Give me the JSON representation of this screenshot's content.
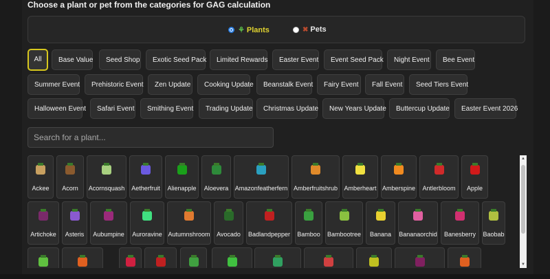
{
  "heading": "Choose a plant or pet from the categories for GAG calculation",
  "type_selector": {
    "plants_label": "Plants",
    "pets_label": "Pets",
    "selected": "Plants"
  },
  "categories": [
    "All",
    "Base Value",
    "Seed Shop",
    "Exotic Seed Pack",
    "Limited Rewards",
    "Easter Event",
    "Event Seed Pack",
    "Night Event",
    "Bee Event",
    "Summer Event",
    "Prehistoric Event",
    "Zen Update",
    "Cooking Update",
    "Beanstalk Event",
    "Fairy Event",
    "Fall Event",
    "Seed Tiers Event",
    "Halloween Event",
    "Safari Event",
    "Smithing Event",
    "Trading Update",
    "Christmas Update",
    "New Years Update",
    "Buttercup Update",
    "Easter Event 2026"
  ],
  "active_category": "All",
  "search": {
    "placeholder": "Search for a plant..."
  },
  "plants": [
    {
      "name": "Ackee",
      "color": "#c8a060",
      "icon": "ackee-icon"
    },
    {
      "name": "Acorn",
      "color": "#8a5a2e",
      "icon": "acorn-icon"
    },
    {
      "name": "Acornsquash",
      "color": "#a8d080",
      "icon": "acornsquash-icon"
    },
    {
      "name": "Aetherfruit",
      "color": "#6a5ae0",
      "icon": "aetherfruit-icon"
    },
    {
      "name": "Alienapple",
      "color": "#1aa01a",
      "icon": "alienapple-icon"
    },
    {
      "name": "Aloevera",
      "color": "#2e8a3a",
      "icon": "aloevera-icon"
    },
    {
      "name": "Amazonfeatherfern",
      "color": "#2aa0c0",
      "icon": "amazonfeatherfern-icon"
    },
    {
      "name": "Amberfruitshrub",
      "color": "#e08a2a",
      "icon": "amberfruitshrub-icon"
    },
    {
      "name": "Amberheart",
      "color": "#f0e040",
      "icon": "amberheart-icon"
    },
    {
      "name": "Amberspine",
      "color": "#f08a20",
      "icon": "amberspine-icon"
    },
    {
      "name": "Antlerbloom",
      "color": "#d02a2a",
      "icon": "antlerbloom-icon"
    },
    {
      "name": "Apple",
      "color": "#d01a1a",
      "icon": "apple-icon"
    },
    {
      "name": "Artichoke",
      "color": "#7a2a6a",
      "icon": "artichoke-icon"
    },
    {
      "name": "Asteris",
      "color": "#8a5ad0",
      "icon": "asteris-icon"
    },
    {
      "name": "Aubumpine",
      "color": "#9a2a7a",
      "icon": "aubumpine-icon"
    },
    {
      "name": "Auroravine",
      "color": "#40e080",
      "icon": "auroravine-icon"
    },
    {
      "name": "Autumnshroom",
      "color": "#e07a30",
      "icon": "autumnshroom-icon"
    },
    {
      "name": "Avocado",
      "color": "#2a6a2a",
      "icon": "avocado-icon"
    },
    {
      "name": "Badlandpepper",
      "color": "#c02020",
      "icon": "badlandpepper-icon"
    },
    {
      "name": "Bamboo",
      "color": "#3aa040",
      "icon": "bamboo-icon"
    },
    {
      "name": "Bambootree",
      "color": "#8ac040",
      "icon": "bambootree-icon"
    },
    {
      "name": "Banana",
      "color": "#e8d030",
      "icon": "banana-icon"
    },
    {
      "name": "Bananaorchid",
      "color": "#e060a0",
      "icon": "bananaorchid-icon"
    },
    {
      "name": "Banesberry",
      "color": "#d03070",
      "icon": "banesberry-icon"
    },
    {
      "name": "Baobab",
      "color": "#b0c040",
      "icon": "baobab-icon"
    },
    {
      "name": "",
      "color": "#60c040",
      "icon": "plant-icon"
    },
    {
      "name": "",
      "color": "#e06020",
      "icon": "plant-icon"
    },
    {
      "name": "",
      "color": "#d02040",
      "icon": "plant-icon"
    },
    {
      "name": "",
      "color": "#c02020",
      "icon": "plant-icon"
    },
    {
      "name": "",
      "color": "#40a040",
      "icon": "plant-icon"
    },
    {
      "name": "",
      "color": "#40c040",
      "icon": "plant-icon"
    },
    {
      "name": "",
      "color": "#30a060",
      "icon": "plant-icon"
    },
    {
      "name": "",
      "color": "#d04040",
      "icon": "plant-icon"
    },
    {
      "name": "",
      "color": "#c0c020",
      "icon": "plant-icon"
    },
    {
      "name": "",
      "color": "#802060",
      "icon": "plant-icon"
    },
    {
      "name": "",
      "color": "#e06020",
      "icon": "plant-icon"
    }
  ]
}
